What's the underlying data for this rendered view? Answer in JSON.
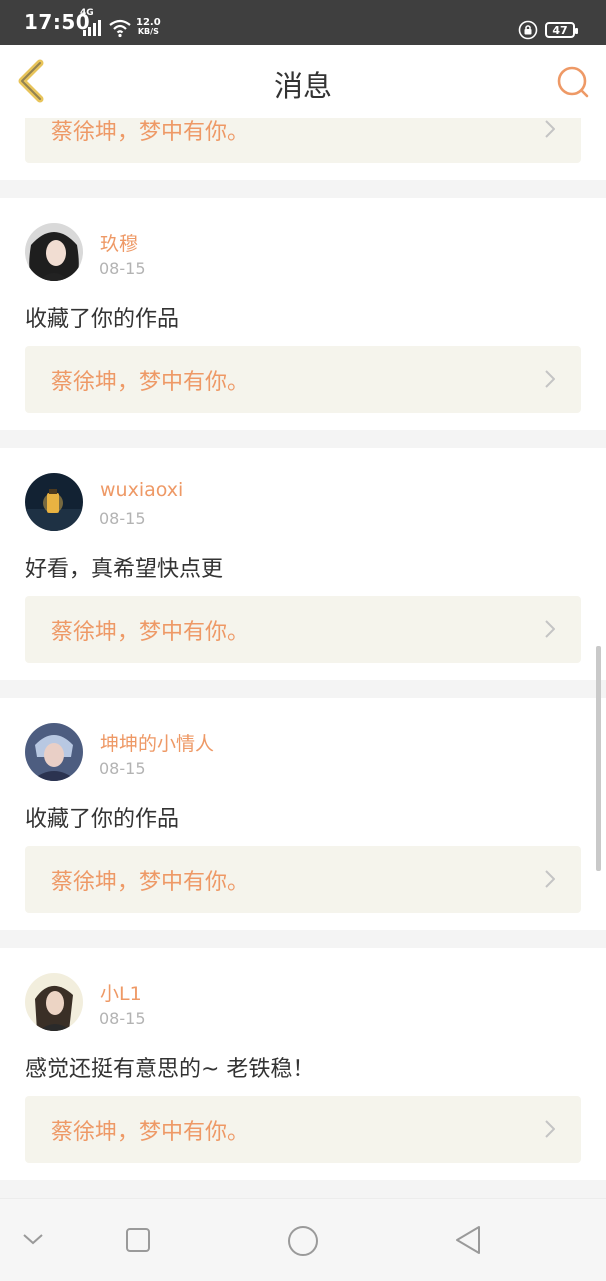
{
  "status_bar": {
    "time": "17:50",
    "network_label": "4G",
    "speed_value": "12.0",
    "speed_unit": "KB/S",
    "battery": "47"
  },
  "header": {
    "title": "消息",
    "back_icon": "chevron-left-icon",
    "search_icon": "search-icon"
  },
  "messages": [
    {
      "username": "玖穆",
      "date": "08-15",
      "text": "收藏了你的作品",
      "link": "蔡徐坤，梦中有你。"
    },
    {
      "username": "wuxiaoxi",
      "date": "08-15",
      "text": "好看，真希望快点更",
      "link": "蔡徐坤，梦中有你。"
    },
    {
      "username": "坤坤的小情人",
      "date": "08-15",
      "text": "收藏了你的作品",
      "link": "蔡徐坤，梦中有你。"
    },
    {
      "username": "小L1",
      "date": "08-15",
      "text": "感觉还挺有意思的~ 老铁稳！",
      "link": "蔡徐坤，梦中有你。"
    }
  ],
  "partial_top_link": "蔡徐坤，梦中有你。",
  "colors": {
    "accent": "#ee9966",
    "card_link_bg": "#f5f4ec",
    "status_bar": "#3f3f3f"
  },
  "nav": {
    "items": [
      "chevron-down-icon",
      "square-icon",
      "circle-icon",
      "triangle-back-icon"
    ]
  }
}
